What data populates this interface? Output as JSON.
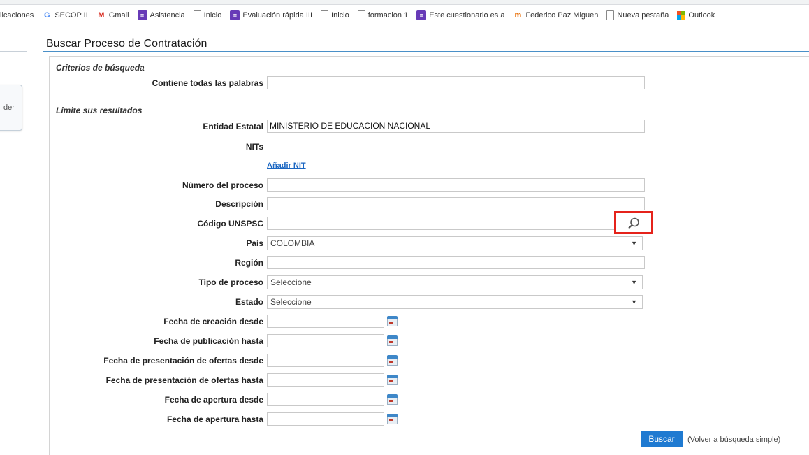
{
  "bookmarks": [
    {
      "label": "licaciones",
      "icon": "none"
    },
    {
      "label": "SECOP II",
      "icon": "google-icon"
    },
    {
      "label": "Gmail",
      "icon": "gmail-icon"
    },
    {
      "label": "Asistencia",
      "icon": "forms-icon"
    },
    {
      "label": "Inicio",
      "icon": "page-icon"
    },
    {
      "label": "Evaluación rápida III",
      "icon": "forms-icon"
    },
    {
      "label": "Inicio",
      "icon": "page-icon"
    },
    {
      "label": "formacion 1",
      "icon": "page-icon"
    },
    {
      "label": "Este cuestionario es a",
      "icon": "forms-icon"
    },
    {
      "label": "Federico Paz Miguen",
      "icon": "fm-icon"
    },
    {
      "label": "Nueva pestaña",
      "icon": "page-icon"
    },
    {
      "label": "Outlook",
      "icon": "microsoft-icon"
    }
  ],
  "side_button_text": "der",
  "page_title": "Buscar Proceso de Contratación",
  "criteria_section": "Criterios de búsqueda",
  "limit_section": "Limite sus resultados",
  "fields": {
    "all_words": {
      "label": "Contiene todas las palabras",
      "value": ""
    },
    "entity": {
      "label": "Entidad Estatal",
      "value": "MINISTERIO DE EDUCACION NACIONAL"
    },
    "nits": {
      "label": "NITs"
    },
    "add_nit": "Añadir NIT",
    "process_number": {
      "label": "Número del proceso",
      "value": ""
    },
    "description": {
      "label": "Descripción",
      "value": ""
    },
    "unspsc": {
      "label": "Código UNSPSC",
      "value": ""
    },
    "country": {
      "label": "País",
      "value": "COLOMBIA"
    },
    "region": {
      "label": "Región",
      "value": ""
    },
    "process_type": {
      "label": "Tipo de proceso",
      "value": "Seleccione"
    },
    "status": {
      "label": "Estado",
      "value": "Seleccione"
    },
    "creation_from": {
      "label": "Fecha de creación desde"
    },
    "publication_to": {
      "label": "Fecha de publicación hasta"
    },
    "offers_from": {
      "label": "Fecha de presentación de ofertas desde"
    },
    "offers_to": {
      "label": "Fecha de presentación de ofertas hasta"
    },
    "opening_from": {
      "label": "Fecha de apertura desde"
    },
    "opening_to": {
      "label": "Fecha de apertura hasta"
    }
  },
  "search_button": "Buscar",
  "simple_search_link": "(Volver a búsqueda simple)",
  "colors": {
    "accent": "#1f7ad1",
    "highlight_box": "#e5231b",
    "link": "#1a66c2"
  }
}
